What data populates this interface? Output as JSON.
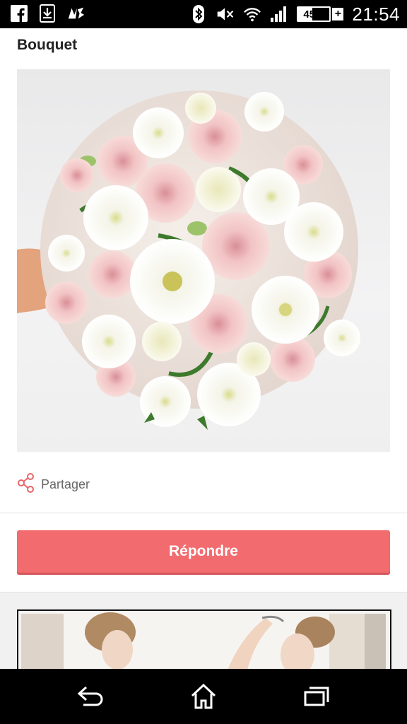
{
  "status_bar": {
    "notification_icons": [
      "facebook-icon",
      "download-icon",
      "nrj-radio-icon"
    ],
    "system_icons": [
      "bluetooth-icon",
      "mute-icon",
      "wifi-icon",
      "signal-icon"
    ],
    "battery_percent": "45%",
    "battery_level": 0.45,
    "battery_charging_symbol": "+",
    "time": "21:54"
  },
  "post": {
    "title": "Bouquet",
    "image_subject": "bridal bouquet of pink roses and white lisianthus"
  },
  "share": {
    "icon": "share-icon",
    "label": "Partager"
  },
  "reply_button": {
    "label": "Répondre"
  },
  "colors": {
    "accent": "#f16b6f",
    "status_bar_bg": "#000000",
    "nav_bar_bg": "#000000"
  },
  "nav_bar": {
    "buttons": [
      "back-icon",
      "home-icon",
      "recent-apps-icon"
    ]
  }
}
